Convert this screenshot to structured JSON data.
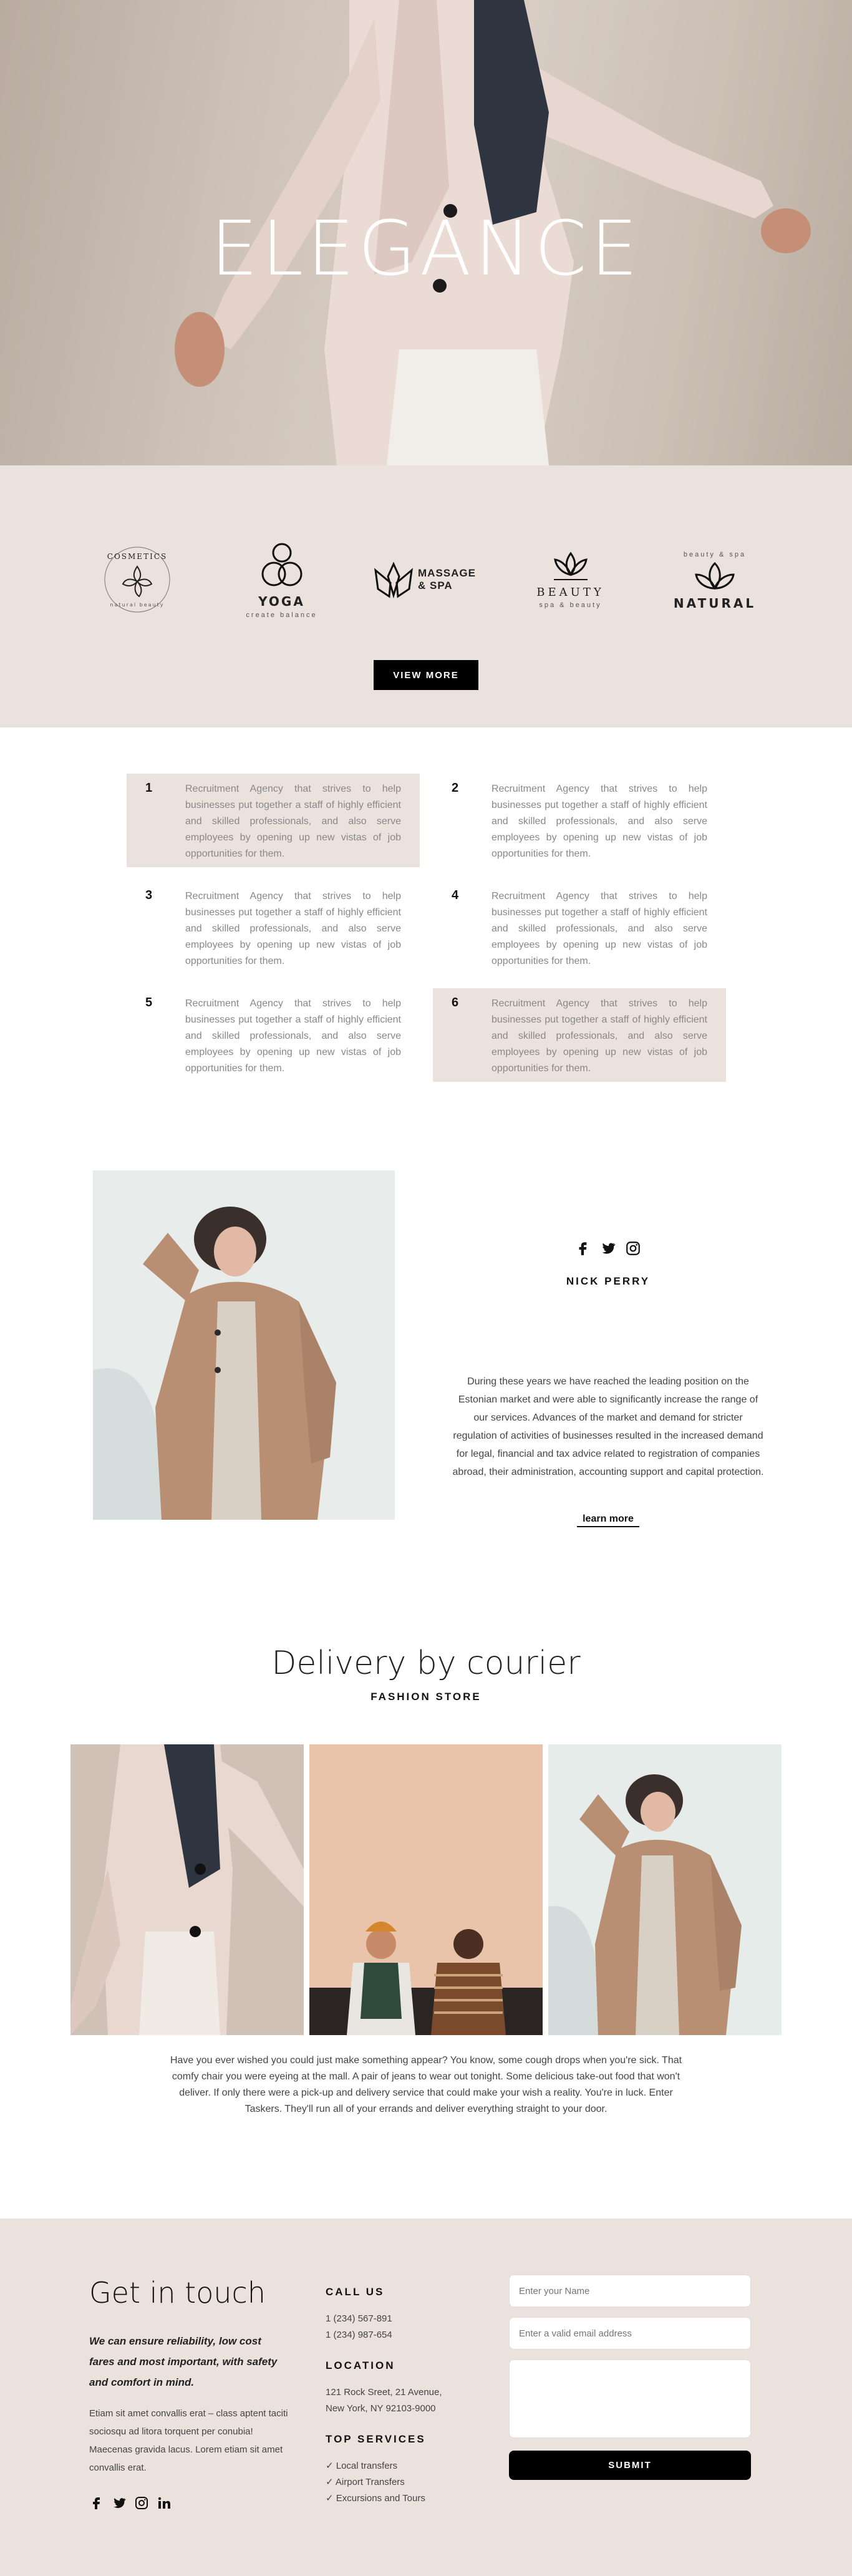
{
  "hero": {
    "title": "ELEGANCE"
  },
  "logos": [
    {
      "name": "cosmetics",
      "text": "COSMETICS",
      "sub": "natural beauty"
    },
    {
      "name": "yoga",
      "text": "YOGA",
      "sub": "create balance"
    },
    {
      "name": "massage-spa",
      "text": "MASSAGE & SPA",
      "sub": ""
    },
    {
      "name": "beauty",
      "text": "BEAUTY",
      "sub": "spa & beauty"
    },
    {
      "name": "natural",
      "text": "NATURAL",
      "sub": "beauty & spa"
    }
  ],
  "view_more": "VIEW MORE",
  "features": [
    {
      "num": "1",
      "text": "Recruitment Agency that strives to help businesses put together a staff of highly efficient and skilled professionals, and also serve employees by opening up new vistas of job opportunities for them."
    },
    {
      "num": "2",
      "text": "Recruitment Agency that strives to help businesses put together a staff of highly efficient and skilled professionals, and also serve employees by opening up new vistas of job opportunities for them."
    },
    {
      "num": "3",
      "text": "Recruitment Agency that strives to help businesses put together a staff of highly efficient and skilled professionals, and also serve employees by opening up new vistas of job opportunities for them."
    },
    {
      "num": "4",
      "text": "Recruitment Agency that strives to help businesses put together a staff of highly efficient and skilled professionals, and also serve employees by opening up new vistas of job opportunities for them."
    },
    {
      "num": "5",
      "text": "Recruitment Agency that strives to help businesses put together a staff of highly efficient and skilled professionals, and also serve employees by opening up new vistas of job opportunities for them."
    },
    {
      "num": "6",
      "text": "Recruitment Agency that strives to help businesses put together a staff of highly efficient and skilled professionals, and also serve employees by opening up new vistas of job opportunities for them."
    }
  ],
  "profile": {
    "name": "NICK PERRY",
    "description": "During these years we have reached the leading position on the Estonian market and were able to significantly increase the range of our services. Advances of the market and demand for stricter regulation of activities of businesses resulted in the increased demand for legal, financial and tax advice related to registration of companies abroad, their administration, accounting support and capital protection.",
    "link": "learn more",
    "social_icons": [
      "facebook-icon",
      "twitter-icon",
      "instagram-icon"
    ]
  },
  "delivery": {
    "title": "Delivery by courier",
    "subtitle": "FASHION STORE",
    "text": "Have you ever wished you could just make something appear? You know, some cough drops when you're sick. That comfy chair you were eyeing at the mall. A pair of jeans to wear out tonight. Some delicious take-out food that won't deliver. If only there were a pick-up and delivery service that could make your wish a reality. You're in luck. Enter Taskers. They'll run all of your errands and deliver everything straight to your door."
  },
  "contact": {
    "title": "Get in touch",
    "lead": "We can ensure reliability, low cost fares and most important, with safety and comfort in mind.",
    "body": "Etiam sit amet convallis erat – class aptent taciti sociosqu ad litora torquent per conubia! Maecenas gravida lacus. Lorem etiam sit amet convallis erat.",
    "call_heading": "CALL US",
    "phones": [
      "1 (234) 567-891",
      "1 (234) 987-654"
    ],
    "location_heading": "LOCATION",
    "address": [
      "121 Rock Sreet, 21 Avenue,",
      "New York, NY 92103-9000"
    ],
    "services_heading": "TOP SERVICES",
    "services": [
      "✓  Local transfers",
      "✓  Airport Transfers",
      "✓  Excursions and Tours"
    ],
    "name_placeholder": "Enter your Name",
    "email_placeholder": "Enter a valid email address",
    "submit": "SUBMIT",
    "social_icons": [
      "facebook-icon",
      "twitter-icon",
      "instagram-icon",
      "linkedin-icon"
    ]
  }
}
